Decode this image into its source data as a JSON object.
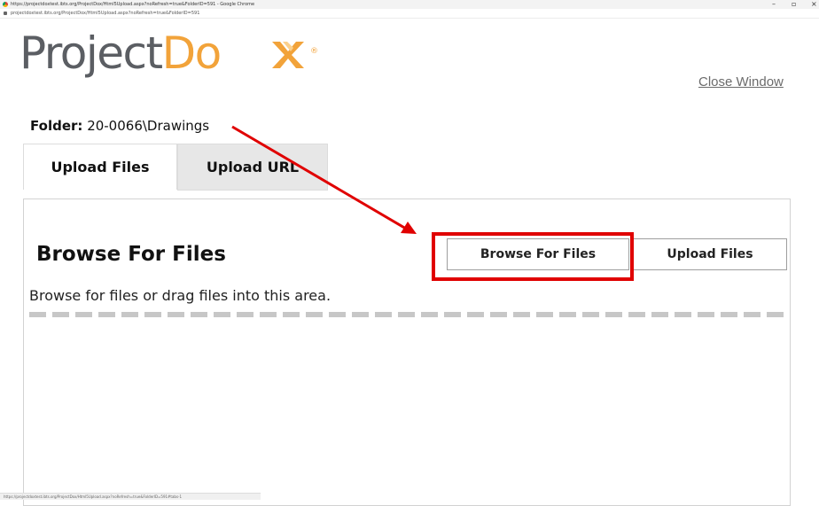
{
  "window": {
    "title": "https://projectdoxtest.ibts.org/ProjectDox/Html5Upload.aspx?noRefresh=true&FolderID=591 - Google Chrome",
    "url": "projectdoxtest.ibts.org/ProjectDox/Html5Upload.aspx?noRefresh=true&FolderID=591",
    "minimize": "–",
    "maximize": "▫",
    "close": "×"
  },
  "logo": {
    "part1": "Project",
    "part2": "Do",
    "reg": "®",
    "colors": {
      "gray": "#5b5e63",
      "orange": "#f2a33a"
    }
  },
  "header": {
    "close_window": "Close Window"
  },
  "folder": {
    "label": "Folder:",
    "path": "20-0066\\Drawings"
  },
  "tabs": [
    {
      "label": "Upload Files",
      "active": true
    },
    {
      "label": "Upload URL",
      "active": false
    }
  ],
  "panel": {
    "heading": "Browse For Files",
    "browse_button": "Browse For Files",
    "upload_button": "Upload Files",
    "hint": "Browse for files or drag files into this area."
  },
  "annotation": {
    "highlight_color": "#e00000"
  },
  "statusbar": {
    "text": "https://projectdoxtest.ibts.org/ProjectDox/Html5Upload.aspx?noRefresh=true&FolderID=591#tabs-1"
  }
}
